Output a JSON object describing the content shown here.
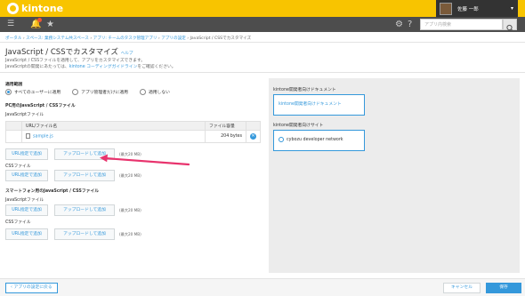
{
  "header": {
    "logo_text": "kintone",
    "user_name": "佐藤 一郎",
    "search_placeholder": "アプリ内検索"
  },
  "nav_icons": [
    "home-icon",
    "bell-icon",
    "star-icon",
    "gear-icon",
    "help-icon"
  ],
  "breadcrumb": {
    "items": [
      "ポータル",
      "スペース: 業務システム共スペース",
      "アプリ: チームのタスク管理アプリ",
      "アプリの設定"
    ],
    "separator": "›",
    "current": "JavaScript / CSSでカスタマイズ"
  },
  "page": {
    "title": "JavaScript / CSSでカスタマイズ",
    "help_label": "ヘルプ",
    "desc_line1": "JavaScript / CSSファイルを適用して、アプリをカスタマイズできます。",
    "desc_line2_prefix": "JavaScriptの開発にあたっては、",
    "desc_link": "kintone コーディングガイドライン",
    "desc_line2_suffix": "をご確認ください。"
  },
  "scope": {
    "label": "適用範囲",
    "options": [
      "すべてのユーザーに適用",
      "アプリ管理者だけに適用",
      "適用しない"
    ],
    "selected": 0
  },
  "pc": {
    "section_label": "PC用のJavaScript / CSSファイル",
    "js_label": "JavaScriptファイル",
    "table_headers": [
      "URL/ファイル名",
      "ファイル容量"
    ],
    "files": [
      {
        "name": "sample.js",
        "size": "204 bytes"
      }
    ],
    "css_label": "CSSファイル"
  },
  "sp": {
    "section_label": "スマートフォン用のJavaScript / CSSファイル",
    "js_label": "JavaScriptファイル",
    "css_label": "CSSファイル"
  },
  "buttons": {
    "url_add": "URL指定で追加",
    "upload_add": "アップロードして追加",
    "max_size": "(最大20 MB)",
    "back": "アプリの設定に戻る",
    "cancel": "キャンセル",
    "save": "保存"
  },
  "side": {
    "doc_title": "kintone開発者向けドキュメント",
    "doc_card": "kintone開発者向けドキュメント",
    "site_title": "kintone開発者向けサイト",
    "site_card": "cybozu developer network"
  },
  "colors": {
    "brand": "#f8c400",
    "accent": "#3498db",
    "arrow": "#e8336d"
  }
}
